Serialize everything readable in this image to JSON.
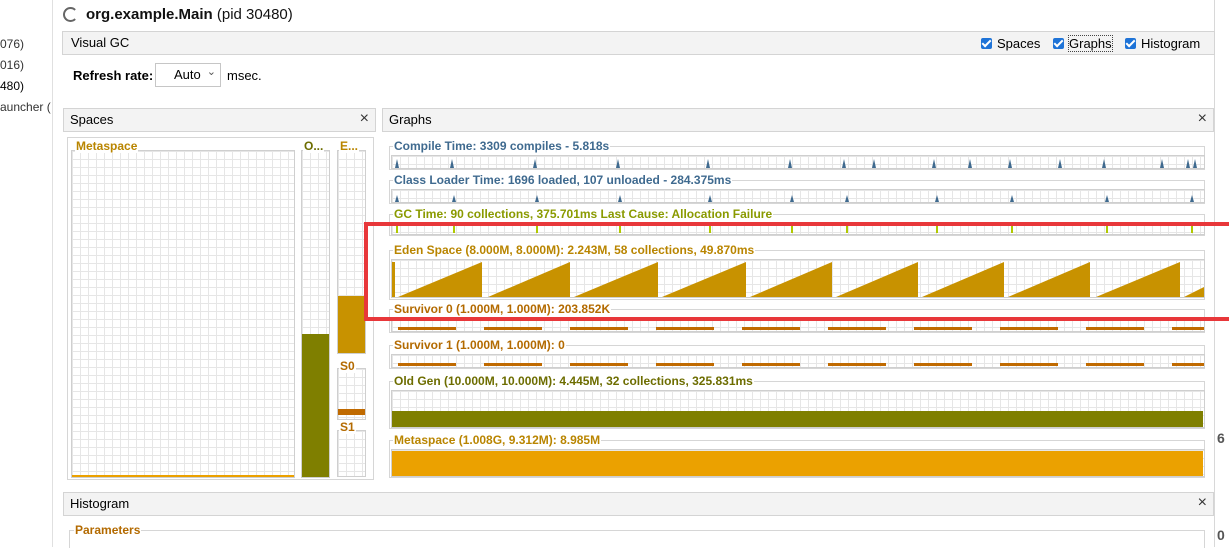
{
  "left_tree": [
    "076)",
    "016)",
    "480)",
    "auncher ("
  ],
  "right_tree": [
    "6",
    "0"
  ],
  "title": {
    "app": "org.example.Main",
    "pid": "(pid 30480)"
  },
  "visual_gc": {
    "title": "Visual GC",
    "checkboxes": [
      {
        "label": "Spaces",
        "checked": true
      },
      {
        "label": "Graphs",
        "checked": true
      },
      {
        "label": "Histogram",
        "checked": true
      }
    ]
  },
  "refresh": {
    "label": "Refresh rate:",
    "value": "Auto",
    "unit": "msec."
  },
  "spaces_panel": {
    "title": "Spaces",
    "close": "×",
    "metaspace_label": "Metaspace",
    "old_label": "O...",
    "eden_label": "E...",
    "s0_label": "S0",
    "s1_label": "S1",
    "old_fill": 0.44,
    "eden_fill": 0.28,
    "s0_fill": 0.2,
    "s1_fill": 0
  },
  "graphs_panel": {
    "title": "Graphs",
    "close": "×",
    "compile": "Compile Time: 3309 compiles - 5.818s",
    "classloader": "Class Loader Time: 1696 loaded, 107 unloaded - 284.375ms",
    "gc": "GC Time: 90 collections, 375.701ms Last Cause: Allocation Failure",
    "eden": "Eden Space (8.000M, 8.000M): 2.243M, 58 collections, 49.870ms",
    "survivor0": "Survivor 0 (1.000M, 1.000M): 203.852K",
    "survivor1": "Survivor 1 (1.000M, 1.000M): 0",
    "oldgen": "Old Gen (10.000M, 10.000M): 4.445M, 32 collections, 325.831ms",
    "metaspace": "Metaspace (1.008G, 9.312M): 8.985M",
    "oldgen_fill": 0.44,
    "metaspace_fill": 0.96
  },
  "histogram": {
    "title": "Histogram",
    "close": "×",
    "parameters": "Parameters"
  },
  "colors": {
    "eden": "#c89200",
    "old": "#7f7f00",
    "survivor": "#c06a00",
    "metaspace": "#eba100",
    "compile": "#3f6a8f",
    "gc": "#b0c800",
    "highlight": "#e8373a"
  }
}
